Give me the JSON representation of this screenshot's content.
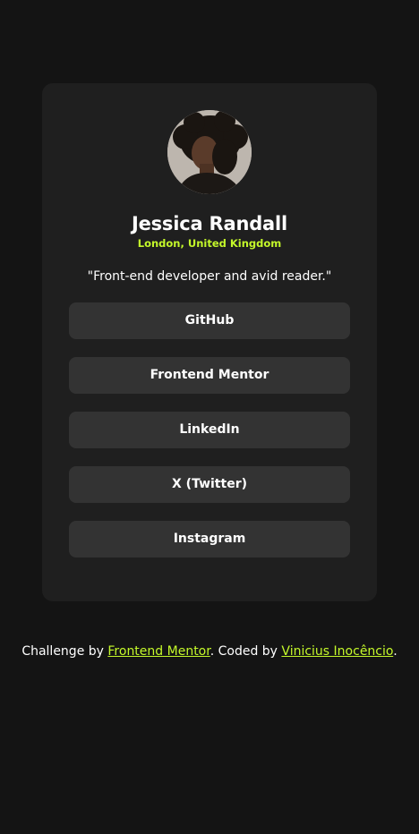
{
  "profile": {
    "name": "Jessica Randall",
    "location": "London, United Kingdom",
    "bio": "\"Front-end developer and avid reader.\"",
    "avatar_icon": "avatar-photo"
  },
  "links": [
    {
      "label": "GitHub"
    },
    {
      "label": "Frontend Mentor"
    },
    {
      "label": "LinkedIn"
    },
    {
      "label": "X (Twitter)"
    },
    {
      "label": "Instagram"
    }
  ],
  "footer": {
    "prefix": "Challenge by ",
    "challenge_link": "Frontend Mentor",
    "middle": ". Coded by ",
    "author_link": "Vinicius Inocêncio",
    "suffix": "."
  },
  "colors": {
    "background": "#141414",
    "card": "#1f1f1f",
    "button": "#333333",
    "accent": "#c4f82a",
    "text": "#ffffff"
  }
}
